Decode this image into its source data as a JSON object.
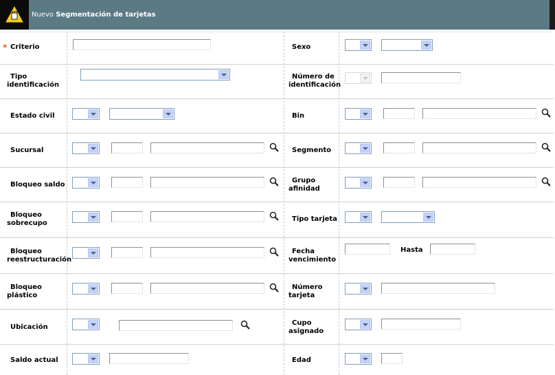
{
  "header": {
    "prefix": "Nuevo",
    "title": "Segmentación de tarjetas"
  },
  "required_marker": "*",
  "labels": {
    "criterio": "Criterio",
    "tipo_identificacion_1": "Tipo",
    "tipo_identificacion_2": "identificación",
    "estado_civil": "Estado civil",
    "sucursal": "Sucursal",
    "bloqueo_saldo": "Bloqueo saldo",
    "bloqueo_sobrecupo_1": "Bloqueo",
    "bloqueo_sobrecupo_2": "sobrecupo",
    "bloqueo_reestructuracion_1": "Bloqueo",
    "bloqueo_reestructuracion_2": "reestructuración",
    "bloqueo_plastico_1": "Bloqueo",
    "bloqueo_plastico_2": "plástico",
    "ubicacion": "Ubicación",
    "saldo_actual": "Saldo actual",
    "sexo": "Sexo",
    "numero_identificacion_1": "Número de",
    "numero_identificacion_2": "identificación",
    "bin": "Bin",
    "segmento": "Segmento",
    "grupo_afinidad_1": "Grupo",
    "grupo_afinidad_2": "afinidad",
    "tipo_tarjeta": "Tipo tarjeta",
    "fecha_vencimiento_1": "Fecha",
    "fecha_vencimiento_2": "vencimiento",
    "hasta": "Hasta",
    "numero_tarjeta_1": "Número",
    "numero_tarjeta_2": "tarjeta",
    "cupo_asignado_1": "Cupo",
    "cupo_asignado_2": "asignado",
    "edad": "Edad"
  },
  "icons": {
    "logo": "new-document-icon",
    "lookup": "magnifier-icon"
  },
  "colors": {
    "header_bg": "#5b7a84",
    "logo_bg": "#0b0b0b",
    "logo_yellow": "#f5cc1b",
    "required": "#e05a2a",
    "select_button": "#c1d3fb"
  }
}
